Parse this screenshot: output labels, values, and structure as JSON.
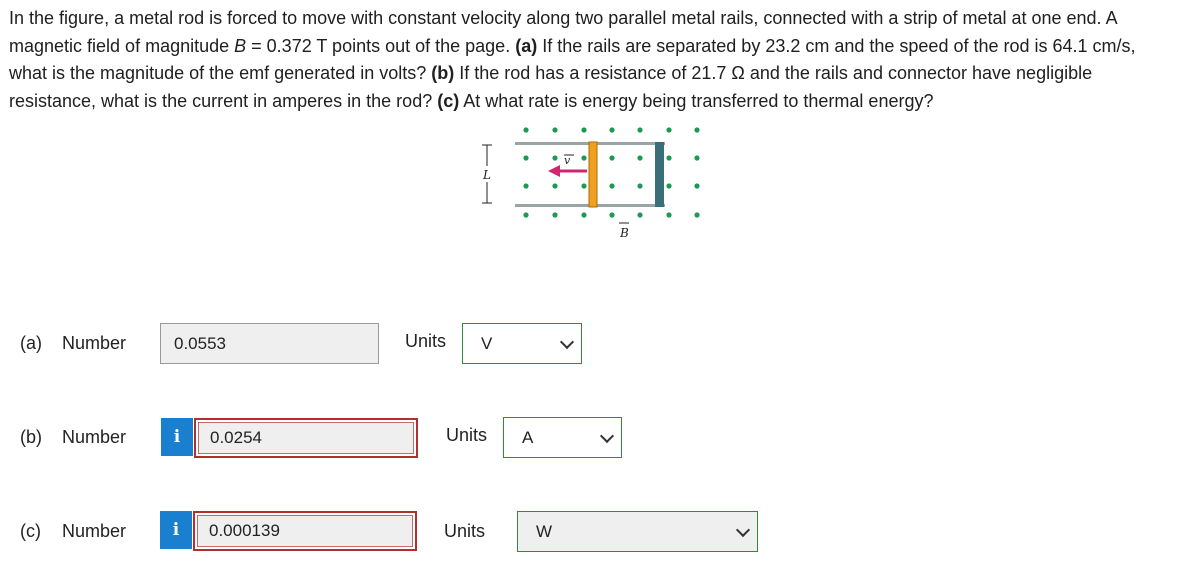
{
  "question": {
    "intro": "In the figure, a metal rod is forced to move with constant velocity along two parallel metal rails, connected with a strip of metal at one end. A magnetic field of magnitude ",
    "b_symbol": "B",
    "b_value": " = 0.372 T points out of the page. ",
    "part_a_tag": "(a)",
    "part_a_text": " If the rails are separated by 23.2 cm and the speed of the rod is 64.1 cm/s, what is the magnitude of the emf generated in volts? ",
    "part_b_tag": "(b)",
    "part_b_text": " If the rod has a resistance of 21.7 Ω and the rails and connector have negligible resistance, what is the current in amperes in the rod? ",
    "part_c_tag": "(c)",
    "part_c_text": " At what rate is energy being transferred to thermal energy?"
  },
  "figure": {
    "label_L": "L",
    "label_v": "v",
    "label_B": "B",
    "colors": {
      "dots": "#1c9a55",
      "rod": "#f0a020",
      "arrow": "#d0266f",
      "connector": "#3a6e78",
      "rail": "#9aa3a6"
    }
  },
  "answers": [
    {
      "part": "(a)",
      "label": "Number",
      "value": "0.0553",
      "state": "plain",
      "units_label": "Units",
      "unit": "V"
    },
    {
      "part": "(b)",
      "label": "Number",
      "value": "0.0254",
      "state": "error",
      "info": "i",
      "units_label": "Units",
      "unit": "A"
    },
    {
      "part": "(c)",
      "label": "Number",
      "value": "0.000139",
      "state": "error",
      "info": "i",
      "units_label": "Units",
      "unit": "W"
    }
  ],
  "colors": {
    "info": "#1a7fcf",
    "error_border": "#b03030",
    "select_border": "#2e8b3a"
  }
}
